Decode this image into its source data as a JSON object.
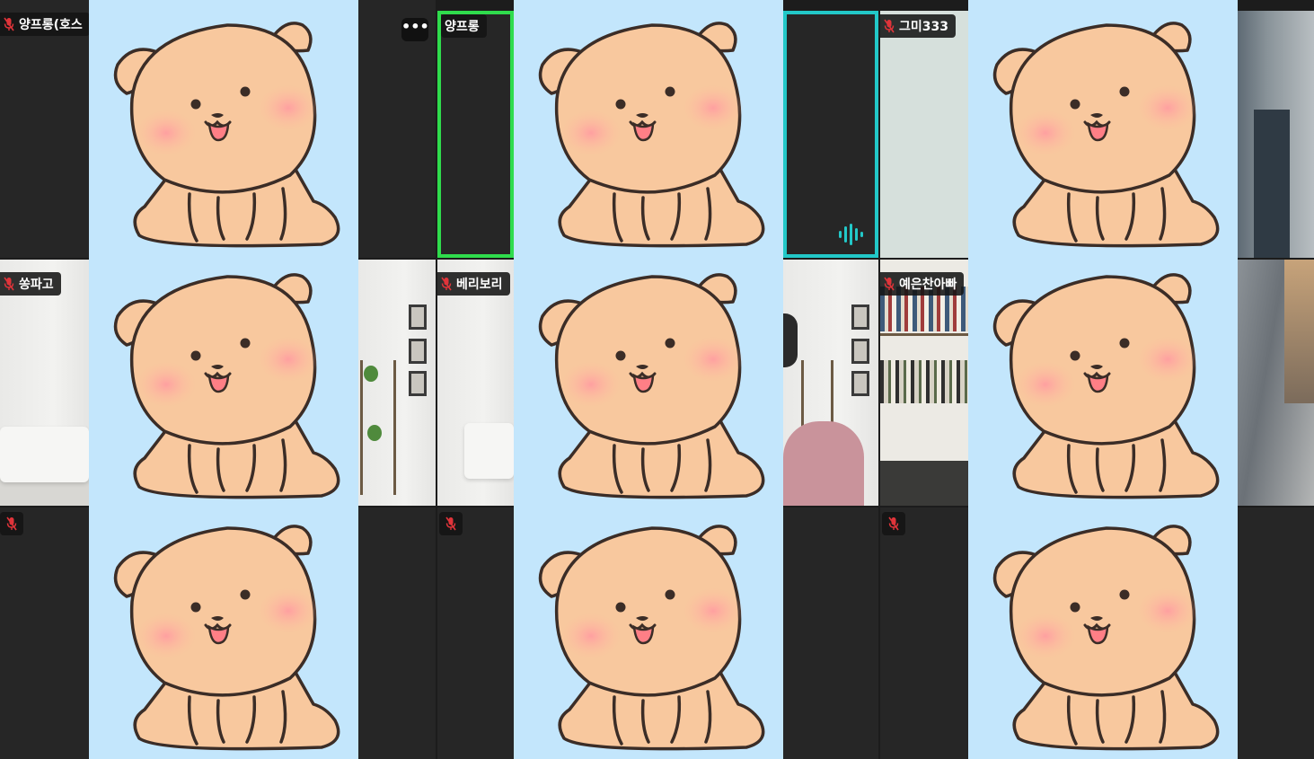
{
  "participants": [
    {
      "name": "양프롱(호스",
      "id": "p1"
    },
    {
      "name": "양프롱",
      "id": "p2"
    },
    {
      "name": "그미333",
      "id": "p3"
    },
    {
      "name": "쏭파고",
      "id": "p4"
    },
    {
      "name": "베리보리",
      "id": "p5"
    },
    {
      "name": "예은찬아빠",
      "id": "p6"
    }
  ],
  "controls": {
    "more_label": "•••"
  },
  "colors": {
    "active_speaker": "#2fdc4c",
    "speaking": "#22c8c8",
    "sticker_bg": "#c3e6fc",
    "muted_mic": "#e0343a"
  },
  "icons": [
    "mic-muted-icon",
    "more-options-icon",
    "audio-waveform-icon",
    "puppy-sticker"
  ]
}
